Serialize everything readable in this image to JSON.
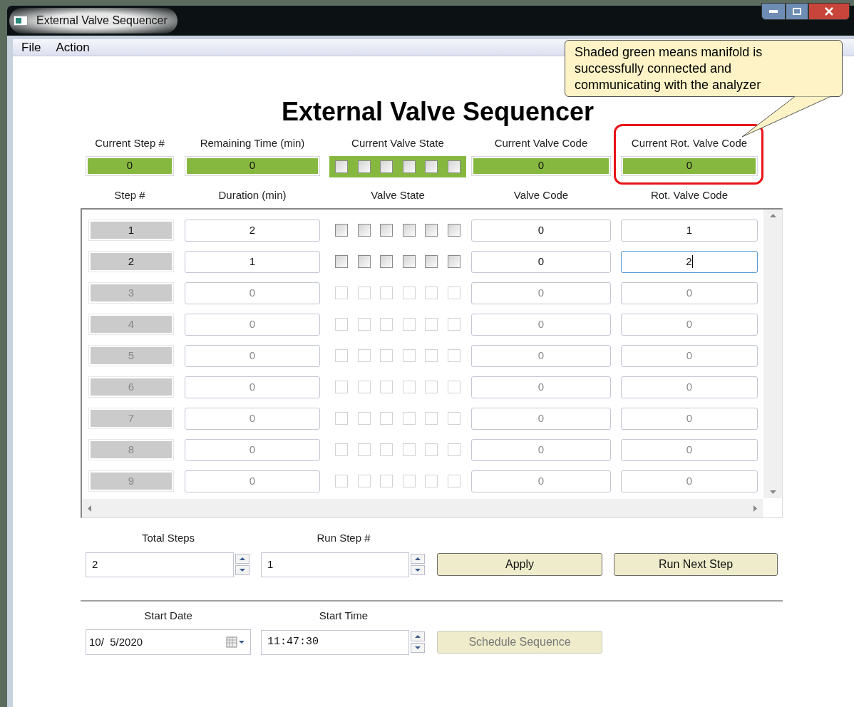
{
  "window": {
    "title": "External Valve Sequencer"
  },
  "menu": [
    {
      "label": "File"
    },
    {
      "label": "Action"
    }
  ],
  "heading": "External Valve Sequencer",
  "callout": {
    "lines": [
      "Shaded green means manifold is",
      "successfully connected and",
      "communicating with the analyzer"
    ]
  },
  "status": [
    {
      "label": "Current Step #",
      "kind": "value",
      "value": "0",
      "connected": true,
      "highlighted": false
    },
    {
      "label": "Remaining Time (min)",
      "kind": "value",
      "value": "0",
      "connected": true,
      "highlighted": false
    },
    {
      "label": "Current Valve State",
      "kind": "valves",
      "valves": [
        false,
        false,
        false,
        false,
        false,
        false
      ],
      "connected": true,
      "highlighted": false
    },
    {
      "label": "Current Valve Code",
      "kind": "value",
      "value": "0",
      "connected": true,
      "highlighted": false
    },
    {
      "label": "Current Rot. Valve Code",
      "kind": "value",
      "value": "0",
      "connected": true,
      "highlighted": true
    }
  ],
  "table": {
    "columns": [
      "Step #",
      "Duration (min)",
      "Valve State",
      "Valve Code",
      "Rot. Valve Code"
    ],
    "rows": [
      {
        "step": "1",
        "duration": "2",
        "valves": [
          false,
          false,
          false,
          false,
          false,
          false
        ],
        "valve_code": "0",
        "rot_valve_code": "1",
        "enabled": true,
        "focused": false
      },
      {
        "step": "2",
        "duration": "1",
        "valves": [
          false,
          false,
          false,
          false,
          false,
          false
        ],
        "valve_code": "0",
        "rot_valve_code": "2",
        "enabled": true,
        "focused": true
      },
      {
        "step": "3",
        "duration": "0",
        "valves": [
          false,
          false,
          false,
          false,
          false,
          false
        ],
        "valve_code": "0",
        "rot_valve_code": "0",
        "enabled": false,
        "focused": false
      },
      {
        "step": "4",
        "duration": "0",
        "valves": [
          false,
          false,
          false,
          false,
          false,
          false
        ],
        "valve_code": "0",
        "rot_valve_code": "0",
        "enabled": false,
        "focused": false
      },
      {
        "step": "5",
        "duration": "0",
        "valves": [
          false,
          false,
          false,
          false,
          false,
          false
        ],
        "valve_code": "0",
        "rot_valve_code": "0",
        "enabled": false,
        "focused": false
      },
      {
        "step": "6",
        "duration": "0",
        "valves": [
          false,
          false,
          false,
          false,
          false,
          false
        ],
        "valve_code": "0",
        "rot_valve_code": "0",
        "enabled": false,
        "focused": false
      },
      {
        "step": "7",
        "duration": "0",
        "valves": [
          false,
          false,
          false,
          false,
          false,
          false
        ],
        "valve_code": "0",
        "rot_valve_code": "0",
        "enabled": false,
        "focused": false
      },
      {
        "step": "8",
        "duration": "0",
        "valves": [
          false,
          false,
          false,
          false,
          false,
          false
        ],
        "valve_code": "0",
        "rot_valve_code": "0",
        "enabled": false,
        "focused": false
      },
      {
        "step": "9",
        "duration": "0",
        "valves": [
          false,
          false,
          false,
          false,
          false,
          false
        ],
        "valve_code": "0",
        "rot_valve_code": "0",
        "enabled": false,
        "focused": false
      }
    ]
  },
  "controls": [
    {
      "label": "Total Steps",
      "kind": "spin",
      "value": "2"
    },
    {
      "label": "Run Step #",
      "kind": "spin",
      "value": "1"
    },
    {
      "kind": "button",
      "label": "Apply",
      "disabled": false
    },
    {
      "kind": "button",
      "label": "Run Next Step",
      "disabled": false
    }
  ],
  "schedule": [
    {
      "label": "Start Date",
      "kind": "date",
      "value": "10/  5/2020"
    },
    {
      "label": "Start Time",
      "kind": "time",
      "value": "11:47:30"
    },
    {
      "kind": "button",
      "label": "Schedule Sequence",
      "disabled": true
    }
  ]
}
